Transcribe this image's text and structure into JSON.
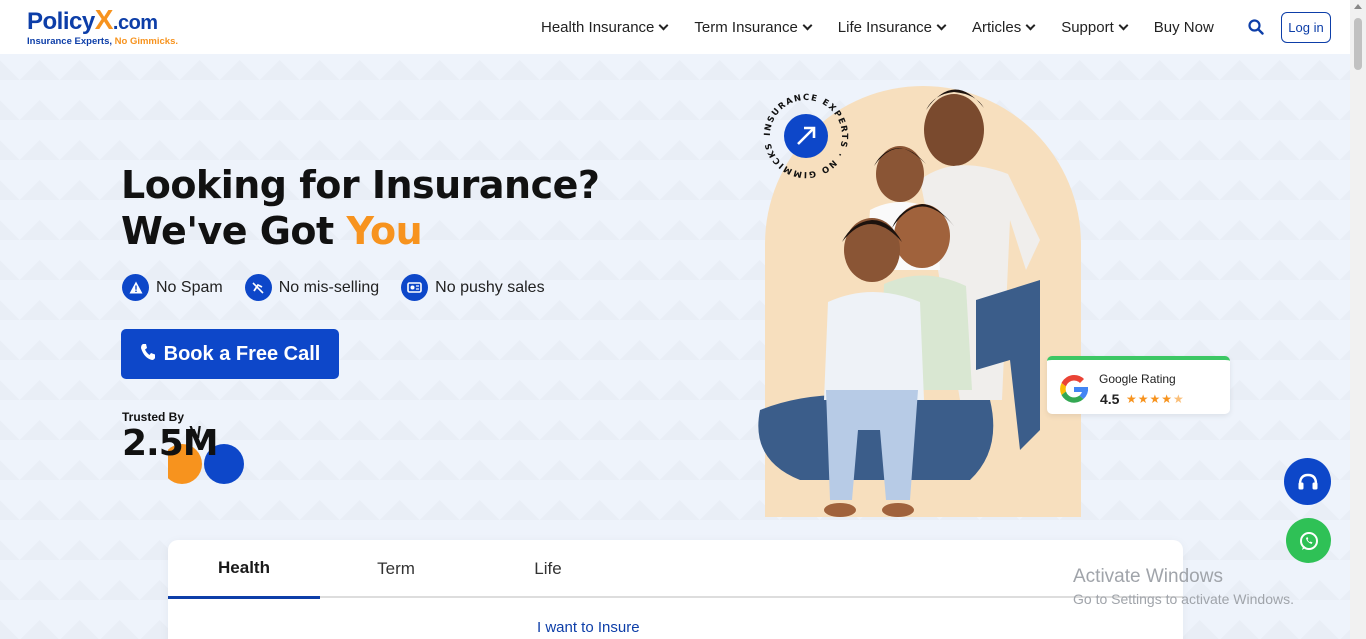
{
  "header": {
    "logo_main": "Policy",
    "logo_x": "X",
    "logo_domain": ".com",
    "logo_tagline_a": "Insurance Experts,",
    "logo_tagline_b": "No Gimmicks.",
    "nav": [
      {
        "label": "Health Insurance",
        "has_dropdown": true
      },
      {
        "label": "Term Insurance",
        "has_dropdown": true
      },
      {
        "label": "Life Insurance",
        "has_dropdown": true
      },
      {
        "label": "Articles",
        "has_dropdown": true
      },
      {
        "label": "Support",
        "has_dropdown": true
      },
      {
        "label": "Buy Now",
        "has_dropdown": false
      }
    ],
    "search_icon": "search-icon",
    "login_label": "Log in"
  },
  "hero": {
    "title_line1": "Looking for Insurance?",
    "title_line2_a": "We've Got",
    "title_line2_b": "You",
    "features": [
      {
        "icon": "alert-icon",
        "label": "No Spam"
      },
      {
        "icon": "no-misselling-icon",
        "label": "No mis-selling"
      },
      {
        "icon": "no-pushy-sales-icon",
        "label": "No pushy sales"
      }
    ],
    "cta_label": "Book a Free Call",
    "trusted_label": "Trusted By",
    "trusted_value": "2.5M"
  },
  "badge": {
    "text": "INSURANCE EXPERTS · NO GIMMICKS"
  },
  "rating": {
    "label": "Google Rating",
    "value": "4.5",
    "stars": 4.5
  },
  "tabs": {
    "items": [
      "Health",
      "Term",
      "Life"
    ],
    "active": "Health",
    "insure_label": "I want to Insure"
  },
  "os_watermark": {
    "title": "Activate Windows",
    "subtitle": "Go to Settings to activate Windows."
  },
  "colors": {
    "brand_blue": "#0d47c9",
    "brand_orange": "#f7931e",
    "whatsapp_green": "#2fc156"
  }
}
